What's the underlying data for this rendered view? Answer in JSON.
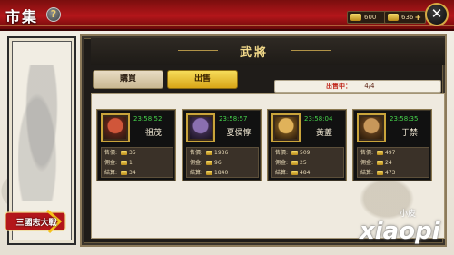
{
  "header": {
    "title": "市集",
    "help_icon": "?",
    "currency_gold": "600",
    "currency_ingot": "636",
    "plus_icon": "+",
    "close_icon": "✕"
  },
  "logo": {
    "text": "三國志大戰"
  },
  "panel": {
    "title": "武將",
    "tabs": [
      {
        "label": "購買",
        "active": false
      },
      {
        "label": "出售",
        "active": true
      }
    ],
    "deploy_label": "出售中：",
    "deploy_value": "4/4"
  },
  "stat_labels": {
    "price": "售價:",
    "commission": "佣金:",
    "earnings": "結算:"
  },
  "generals": [
    {
      "name": "祖茂",
      "timer": "23:58:52",
      "price": "35",
      "commission": "1",
      "earnings": "34"
    },
    {
      "name": "夏侯惇",
      "timer": "23:58:57",
      "price": "1936",
      "commission": "96",
      "earnings": "1840"
    },
    {
      "name": "黃蓋",
      "timer": "23:58:04",
      "price": "509",
      "commission": "25",
      "earnings": "484"
    },
    {
      "name": "于禁",
      "timer": "23:58:35",
      "price": "497",
      "commission": "24",
      "earnings": "473"
    }
  ],
  "watermark": {
    "small": "小皮",
    "big": "xiaopi"
  },
  "colors": {
    "header_red": "#b3161a",
    "gold": "#f1d889",
    "timer_green": "#46d34b",
    "active_tab": "#f6dc5a"
  }
}
